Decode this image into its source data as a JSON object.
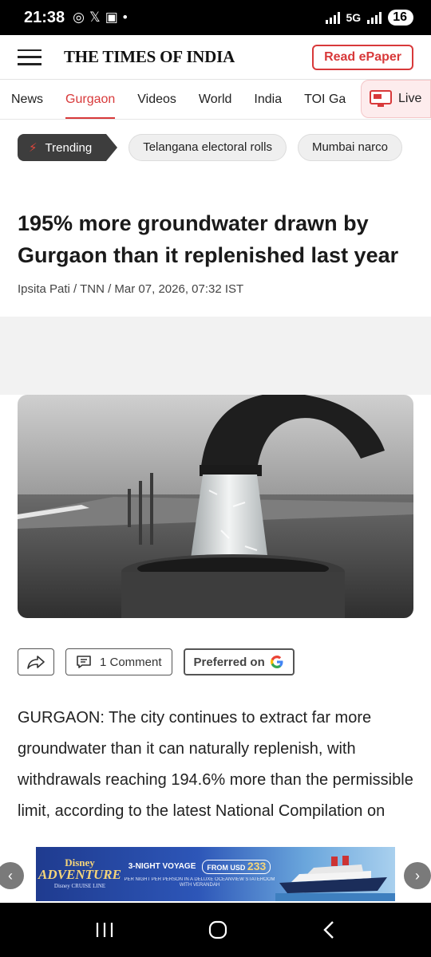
{
  "status": {
    "time": "21:38",
    "battery": "16",
    "network": "5G"
  },
  "header": {
    "logo": "THE TIMES OF INDIA",
    "epaper": "Read ePaper"
  },
  "nav": {
    "items": [
      "News",
      "Gurgaon",
      "Videos",
      "World",
      "India",
      "TOI Ga"
    ],
    "active": "Gurgaon",
    "live": "Live"
  },
  "trending": {
    "label": "Trending",
    "chips": [
      "Telangana electoral rolls",
      "Mumbai narco"
    ]
  },
  "article": {
    "headline": "195% more groundwater drawn by Gurgaon than it replenished last year",
    "byline": "Ipsita Pati / TNN / Mar 07, 2026, 07:32 IST",
    "comment_label": "1 Comment",
    "preferred_label": "Preferred on",
    "body": "GURGAON: The city continues to extract far more groundwater than it can naturally replenish, with withdrawals reaching 194.6% more than the permissible limit, according to the latest National Compilation on Dynamic"
  },
  "ad": {
    "brand": "Disney",
    "brand_line": "ADVENTURE",
    "cruise_line": "Disney CRUISE LINE",
    "voyage": "3-NIGHT VOYAGE",
    "price_from": "FROM USD",
    "price": "233",
    "offer": "PER NIGHT PER PERSON IN A DELUXE OCEANVIEW STATEROOM WITH VERANDAH"
  },
  "colors": {
    "accent": "#d8393a",
    "trending_bg": "#3d3d3d"
  }
}
